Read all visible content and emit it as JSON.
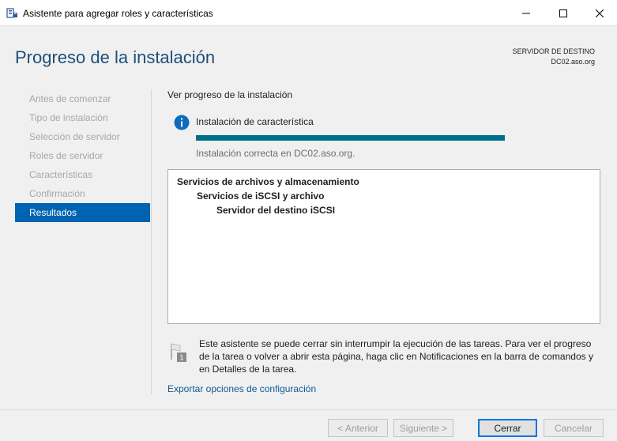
{
  "window": {
    "title": "Asistente para agregar roles y características",
    "icon": "server-manager-icon",
    "controls": [
      "minimize-icon",
      "maximize-icon",
      "close-icon"
    ]
  },
  "header": {
    "page_title": "Progreso de la instalación",
    "destination_label": "SERVIDOR DE DESTINO",
    "destination_server": "DC02.aso.org"
  },
  "nav": {
    "items": [
      {
        "label": "Antes de comenzar"
      },
      {
        "label": "Tipo de instalación"
      },
      {
        "label": "Selección de servidor"
      },
      {
        "label": "Roles de servidor"
      },
      {
        "label": "Características"
      },
      {
        "label": "Confirmación"
      },
      {
        "label": "Resultados"
      }
    ],
    "active_index": 6
  },
  "main": {
    "section_heading": "Ver progreso de la instalación",
    "status_icon": "info-icon",
    "status_heading": "Instalación de característica",
    "progress_percent": 100,
    "status_detail": "Instalación correcta en DC02.aso.org.",
    "results": [
      {
        "text": "Servicios de archivos y almacenamiento",
        "level": 0
      },
      {
        "text": "Servicios de iSCSI y archivo",
        "level": 1
      },
      {
        "text": "Servidor del destino iSCSI",
        "level": 2
      }
    ],
    "note_icon": "flag-notification-icon",
    "note_badge": "1",
    "note_text": "Este asistente se puede cerrar sin interrumpir la ejecución de las tareas. Para ver el progreso de la tarea o volver a abrir esta página, haga clic en Notificaciones en la barra de comandos y en Detalles de la tarea.",
    "export_link": "Exportar opciones de configuración"
  },
  "footer": {
    "prev_label": "< Anterior",
    "next_label": "Siguiente >",
    "close_label": "Cerrar",
    "cancel_label": "Cancelar"
  },
  "colors": {
    "accent": "#0063b1",
    "progress": "#00708a",
    "title": "#1e4e79",
    "link": "#0b5a96"
  }
}
